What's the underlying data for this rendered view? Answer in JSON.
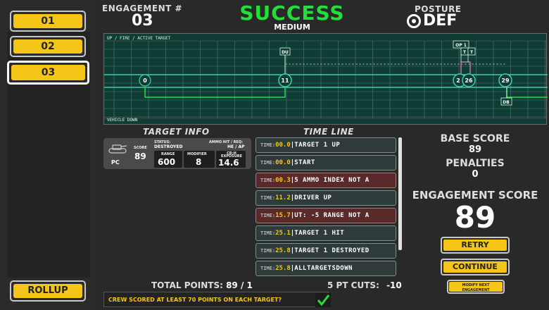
{
  "sidebar": {
    "engagements": [
      "01",
      "02",
      "03"
    ],
    "rollup_label": "ROLLUP"
  },
  "header": {
    "engagement_label": "ENGAGEMENT #",
    "engagement_number": "03",
    "result": "SUCCESS",
    "difficulty": "MEDIUM",
    "posture_label": "POSTURE",
    "posture_value": "DEF"
  },
  "timeline_graph": {
    "top_label": "UP / FIRE / ACTIVE TARGET",
    "bottom_label": "VEHICLE DOWN",
    "markers": [
      "0",
      "11",
      "2",
      "26",
      "29"
    ],
    "tags": [
      "DU",
      "OP 1",
      "T",
      "T",
      "DB"
    ]
  },
  "target_info": {
    "title": "TARGET INFO",
    "score_label": "SCORE",
    "score": "89",
    "type": "PC",
    "status_label": "STATUS:",
    "status": "DESTROYED",
    "ammo_label": "AMMO HIT / REQ:",
    "ammo": "HE / AP",
    "range_label": "RANGE",
    "range": "600",
    "modifier_label": "MODIFIER",
    "modifier": "8",
    "exposure_label": "CR:H EXPOSURE",
    "exposure": "14.6"
  },
  "timeline": {
    "title": "TIME LINE",
    "time_label": "TIME:",
    "entries": [
      {
        "time": "00.0",
        "msg": "TARGET 1 UP",
        "warn": false
      },
      {
        "time": "00.0",
        "msg": "START",
        "warn": false
      },
      {
        "time": "00.3",
        "msg": "5 AMMO INDEX NOT A",
        "warn": true
      },
      {
        "time": "11.2",
        "msg": "DRIVER UP",
        "warn": false
      },
      {
        "time": "15.7",
        "msg": "UT: -5 RANGE NOT A",
        "warn": true
      },
      {
        "time": "25.1",
        "msg": "TARGET 1 HIT",
        "warn": false
      },
      {
        "time": "25.8",
        "msg": "TARGET 1 DESTROYED",
        "warn": false
      },
      {
        "time": "25.8",
        "msg": "ALLTARGETSDOWN",
        "warn": false
      }
    ]
  },
  "scores": {
    "base_label": "BASE SCORE",
    "base": "89",
    "penalties_label": "PENALTIES",
    "penalties": "0",
    "engagement_label": "ENGAGEMENT SCORE",
    "engagement": "89"
  },
  "buttons": {
    "retry": "RETRY",
    "continue": "CONTINUE",
    "modify": "MODIFY NEXT ENGAGEMENT"
  },
  "footer": {
    "total_points_label": "TOTAL POINTS:",
    "total_points": "89 / 1",
    "cuts_label": "5 PT CUTS:",
    "cuts": "-10",
    "crew_question": "CREW SCORED AT LEAST 70 POINTS ON EACH TARGET?"
  },
  "colors": {
    "accent_yellow": "#f5c518",
    "success_green": "#22e03a",
    "graph_bg": "#0f3d36",
    "graph_line": "#3fd0a8"
  },
  "icons": [
    "target-posture-icon",
    "tank-icon",
    "checkmark-icon"
  ]
}
